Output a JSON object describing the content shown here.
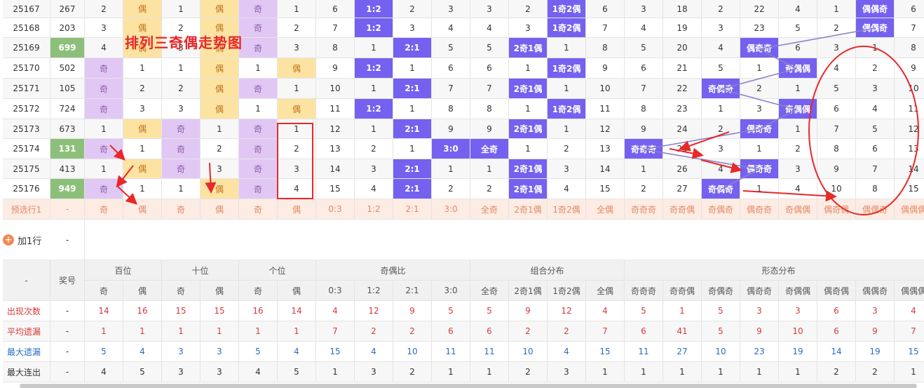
{
  "overlay_title": "排列三奇偶走势图",
  "add_row_label": "加1行",
  "dash": "-",
  "rows": [
    {
      "issue": "25167",
      "prize": "267",
      "prize_green": false,
      "cells": [
        "2",
        "偶",
        "1",
        "偶",
        "奇",
        "1",
        "6",
        "1:2",
        "2",
        "3",
        "3",
        "2",
        "1奇2偶",
        "6",
        "3",
        "18",
        "2",
        "22",
        "4",
        "1",
        "偶偶奇",
        "6"
      ]
    },
    {
      "issue": "25168",
      "prize": "203",
      "prize_green": false,
      "cells": [
        "3",
        "偶",
        "2",
        "偶",
        "奇",
        "2",
        "7",
        "1:2",
        "3",
        "4",
        "4",
        "3",
        "1奇2偶",
        "7",
        "4",
        "19",
        "3",
        "23",
        "5",
        "2",
        "偶偶奇",
        "7"
      ]
    },
    {
      "issue": "25169",
      "prize": "699",
      "prize_green": true,
      "cells": [
        "4",
        "偶",
        "3",
        "偶",
        "奇",
        "3",
        "8",
        "1",
        "2:1",
        "5",
        "5",
        "2奇1偶",
        "1",
        "8",
        "5",
        "20",
        "4",
        "偶奇奇",
        "6",
        "3",
        "1",
        "8"
      ]
    },
    {
      "issue": "25170",
      "prize": "502",
      "prize_green": false,
      "cells": [
        "奇",
        "1",
        "1",
        "偶",
        "1",
        "偶",
        "9",
        "1:2",
        "1",
        "6",
        "6",
        "1",
        "1奇2偶",
        "9",
        "6",
        "21",
        "5",
        "1",
        "奇偶偶",
        "4",
        "2",
        "9"
      ]
    },
    {
      "issue": "25171",
      "prize": "105",
      "prize_green": false,
      "cells": [
        "奇",
        "2",
        "2",
        "偶",
        "奇",
        "1",
        "10",
        "1",
        "2:1",
        "7",
        "7",
        "2奇1偶",
        "1",
        "10",
        "7",
        "22",
        "奇偶奇",
        "2",
        "1",
        "5",
        "3",
        "10"
      ]
    },
    {
      "issue": "25172",
      "prize": "724",
      "prize_green": false,
      "cells": [
        "奇",
        "3",
        "3",
        "偶",
        "1",
        "偶",
        "11",
        "1:2",
        "1",
        "8",
        "8",
        "1",
        "1奇2偶",
        "11",
        "8",
        "23",
        "1",
        "3",
        "奇偶偶",
        "6",
        "4",
        "11"
      ]
    },
    {
      "issue": "25173",
      "prize": "673",
      "prize_green": false,
      "cells": [
        "1",
        "偶",
        "奇",
        "1",
        "奇",
        "1",
        "12",
        "1",
        "2:1",
        "9",
        "9",
        "2奇1偶",
        "1",
        "12",
        "9",
        "24",
        "2",
        "偶奇奇",
        "1",
        "7",
        "5",
        "12"
      ]
    },
    {
      "issue": "25174",
      "prize": "131",
      "prize_green": true,
      "cells": [
        "奇",
        "1",
        "奇",
        "2",
        "奇",
        "2",
        "13",
        "2",
        "1",
        "3:0",
        "全奇",
        "1",
        "2",
        "13",
        "奇奇奇",
        "25",
        "3",
        "1",
        "2",
        "8",
        "6",
        "13"
      ]
    },
    {
      "issue": "25175",
      "prize": "413",
      "prize_green": false,
      "cells": [
        "1",
        "偶",
        "奇",
        "3",
        "奇",
        "3",
        "14",
        "3",
        "2:1",
        "1",
        "1",
        "2奇1偶",
        "3",
        "14",
        "1",
        "26",
        "4",
        "偶奇奇",
        "3",
        "9",
        "7",
        "14"
      ]
    },
    {
      "issue": "25176",
      "prize": "949",
      "prize_green": true,
      "cells": [
        "奇",
        "1",
        "1",
        "偶",
        "奇",
        "4",
        "15",
        "4",
        "2:1",
        "2",
        "2",
        "2奇1偶",
        "4",
        "15",
        "2",
        "27",
        "奇偶奇",
        "1",
        "4",
        "10",
        "8",
        "15"
      ]
    }
  ],
  "select_row": {
    "label": "预选行1",
    "cells": [
      "-",
      "奇",
      "偶",
      "奇",
      "偶",
      "奇",
      "偶",
      "0:3",
      "1:2",
      "2:1",
      "3:0",
      "全奇",
      "2奇1偶",
      "1奇2偶",
      "全偶",
      "奇奇奇",
      "奇奇偶",
      "奇偶奇",
      "偶奇奇",
      "奇偶偶",
      "偶奇偶",
      "偶偶奇",
      "偶偶偶"
    ]
  },
  "header": {
    "first": "-",
    "prize": "奖号",
    "groups": [
      "百位",
      "十位",
      "个位",
      "奇偶比",
      "组合分布",
      "形态分布"
    ],
    "subs": [
      "奇",
      "偶",
      "奇",
      "偶",
      "奇",
      "偶",
      "0:3",
      "1:2",
      "2:1",
      "3:0",
      "全奇",
      "2奇1偶",
      "1奇2偶",
      "全偶",
      "奇奇奇",
      "奇奇偶",
      "奇偶奇",
      "偶奇奇",
      "奇偶偶",
      "偶奇偶",
      "偶偶奇",
      "偶偶偶"
    ]
  },
  "stats": [
    {
      "label": "出现次数",
      "values": [
        "14",
        "16",
        "15",
        "15",
        "16",
        "14",
        "4",
        "12",
        "9",
        "5",
        "5",
        "9",
        "12",
        "4",
        "5",
        "1",
        "5",
        "3",
        "3",
        "6",
        "3",
        "4"
      ]
    },
    {
      "label": "平均遗漏",
      "values": [
        "1",
        "1",
        "1",
        "1",
        "1",
        "1",
        "7",
        "2",
        "2",
        "6",
        "6",
        "2",
        "2",
        "7",
        "6",
        "41",
        "5",
        "9",
        "10",
        "6",
        "9",
        "7"
      ]
    },
    {
      "label": "最大遗漏",
      "values": [
        "5",
        "4",
        "3",
        "3",
        "5",
        "4",
        "15",
        "4",
        "10",
        "11",
        "11",
        "10",
        "4",
        "15",
        "11",
        "27",
        "10",
        "23",
        "19",
        "14",
        "19",
        "15"
      ]
    },
    {
      "label": "最大连出",
      "values": [
        "4",
        "5",
        "3",
        "3",
        "4",
        "5",
        "1",
        "3",
        "2",
        "1",
        "1",
        "2",
        "3",
        "1",
        "1",
        "1",
        "1",
        "1",
        "1",
        "2",
        "2",
        "1"
      ]
    }
  ],
  "colors": {
    "odd_hit": "#e1c8f4",
    "even_hit": "#fde3a2",
    "blue_hit": "#7561f0",
    "green_prize": "#8cc07a",
    "annotation_red": "#e8282a",
    "trend_line": "#8a80c8"
  }
}
